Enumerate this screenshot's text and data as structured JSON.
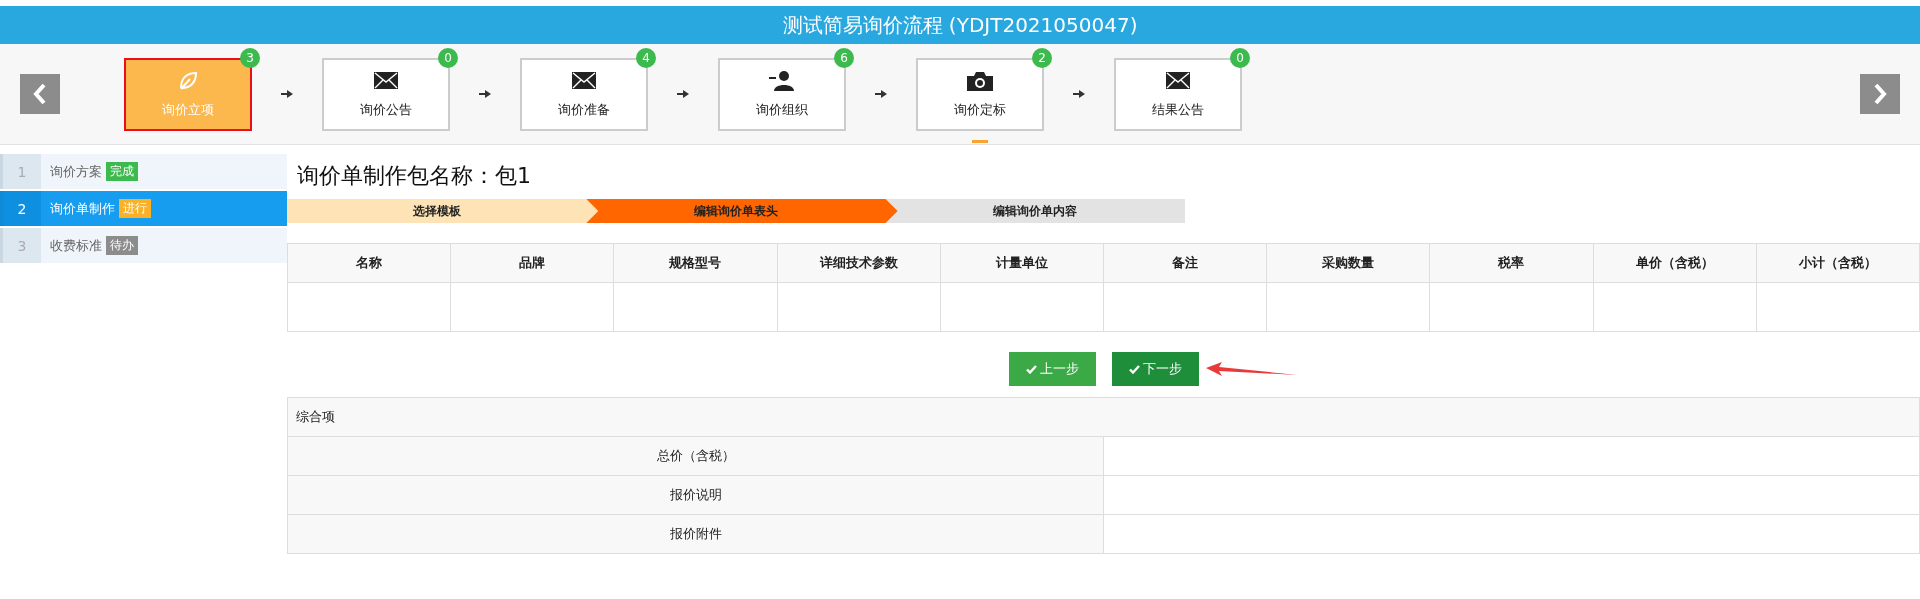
{
  "window": {
    "title": "测试简易询价流程 (YDJT2021050047)"
  },
  "steps": [
    {
      "label": "询价立项",
      "kind": "leaf",
      "count": "3",
      "selected": true,
      "current": false
    },
    {
      "label": "询价公告",
      "kind": "envelope",
      "count": "0",
      "selected": false,
      "current": false
    },
    {
      "label": "询价准备",
      "kind": "envelope",
      "count": "4",
      "selected": false,
      "current": false
    },
    {
      "label": "询价组织",
      "kind": "person",
      "count": "6",
      "selected": false,
      "current": false
    },
    {
      "label": "询价定标",
      "kind": "camera",
      "count": "2",
      "selected": false,
      "current": true
    },
    {
      "label": "结果公告",
      "kind": "envelope",
      "count": "0",
      "selected": false,
      "current": false
    }
  ],
  "sidebar": {
    "items": [
      {
        "number": "1",
        "label": "询价方案",
        "badge": "完成",
        "kind": "done",
        "selected": false
      },
      {
        "number": "2",
        "label": "询价单制作",
        "badge": "进行",
        "kind": "doing",
        "selected": true
      },
      {
        "number": "3",
        "label": "收费标准",
        "badge": "待办",
        "kind": "todo",
        "selected": false
      }
    ]
  },
  "page_title": "询价单制作包名称：包1",
  "wizard": [
    {
      "label": "选择模板",
      "kind": "done"
    },
    {
      "label": "编辑询价单表头",
      "kind": "active"
    },
    {
      "label": "编辑询价单内容",
      "kind": "pending"
    }
  ],
  "table": {
    "columns": [
      "名称",
      "品牌",
      "规格型号",
      "详细技术参数",
      "计量单位",
      "备注",
      "采购数量",
      "税率",
      "单价（含税）",
      "小计（含税）"
    ]
  },
  "buttons": [
    {
      "label": "上一步",
      "primary": false
    },
    {
      "label": "下一步",
      "primary": true
    }
  ],
  "summary": {
    "title": "综合项",
    "rows": [
      "总价（含税）",
      "报价说明",
      "报价附件"
    ]
  }
}
